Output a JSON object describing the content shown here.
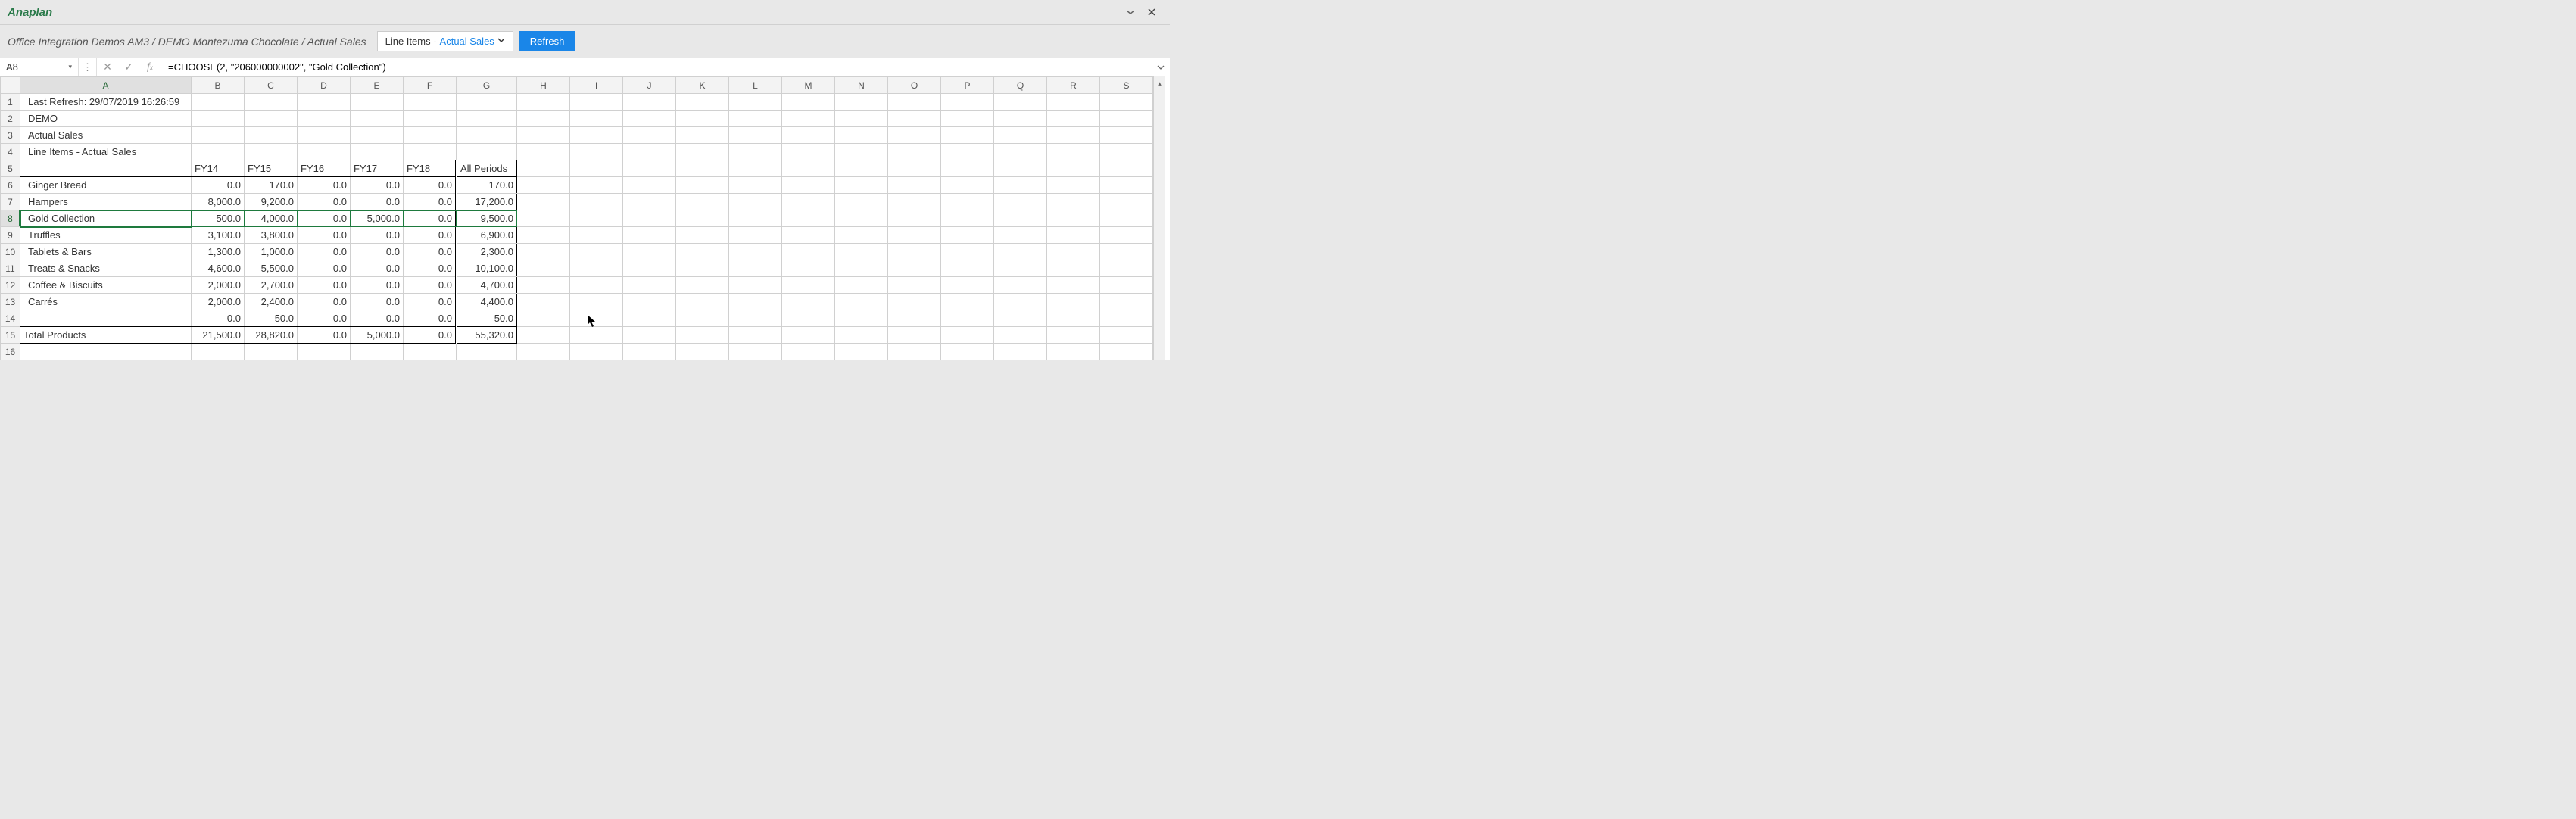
{
  "app": {
    "title": "Anaplan",
    "dropdown_label": "▾",
    "close_label": "✕"
  },
  "ribbon": {
    "breadcrumb": "Office Integration Demos AM3 / DEMO Montezuma Chocolate / Actual Sales",
    "selector_static": "Line Items - ",
    "selector_value": "Actual Sales",
    "refresh_label": "Refresh"
  },
  "formula_bar": {
    "cell_ref": "A8",
    "formula": "=CHOOSE(2, \"206000000002\", \"Gold Collection\")"
  },
  "sheet": {
    "columns": [
      "A",
      "B",
      "C",
      "D",
      "E",
      "F",
      "G",
      "H",
      "I",
      "J",
      "K",
      "L",
      "M",
      "N",
      "O",
      "P",
      "Q",
      "R",
      "S"
    ],
    "selected_row": 8,
    "selected_col": 0,
    "meta_rows": [
      "Last Refresh: 29/07/2019 16:26:59",
      "DEMO",
      "Actual Sales",
      "Line Items - Actual Sales"
    ],
    "table": {
      "headers": [
        "",
        "FY14",
        "FY15",
        "FY16",
        "FY17",
        "FY18",
        "All Periods"
      ],
      "rows": [
        {
          "label": "Ginger Bread",
          "v": [
            "0.0",
            "170.0",
            "0.0",
            "0.0",
            "0.0",
            "170.0"
          ]
        },
        {
          "label": "Hampers",
          "v": [
            "8,000.0",
            "9,200.0",
            "0.0",
            "0.0",
            "0.0",
            "17,200.0"
          ]
        },
        {
          "label": "Gold Collection",
          "v": [
            "500.0",
            "4,000.0",
            "0.0",
            "5,000.0",
            "0.0",
            "9,500.0"
          ]
        },
        {
          "label": "Truffles",
          "v": [
            "3,100.0",
            "3,800.0",
            "0.0",
            "0.0",
            "0.0",
            "6,900.0"
          ]
        },
        {
          "label": "Tablets & Bars",
          "v": [
            "1,300.0",
            "1,000.0",
            "0.0",
            "0.0",
            "0.0",
            "2,300.0"
          ]
        },
        {
          "label": "Treats & Snacks",
          "v": [
            "4,600.0",
            "5,500.0",
            "0.0",
            "0.0",
            "0.0",
            "10,100.0"
          ]
        },
        {
          "label": "Coffee & Biscuits",
          "v": [
            "2,000.0",
            "2,700.0",
            "0.0",
            "0.0",
            "0.0",
            "4,700.0"
          ]
        },
        {
          "label": "Carrés",
          "v": [
            "2,000.0",
            "2,400.0",
            "0.0",
            "0.0",
            "0.0",
            "4,400.0"
          ]
        },
        {
          "label": "",
          "v": [
            "0.0",
            "50.0",
            "0.0",
            "0.0",
            "0.0",
            "50.0"
          ]
        }
      ],
      "total_label": "Total Products",
      "total": [
        "21,500.0",
        "28,820.0",
        "0.0",
        "5,000.0",
        "0.0",
        "55,320.0"
      ]
    }
  }
}
